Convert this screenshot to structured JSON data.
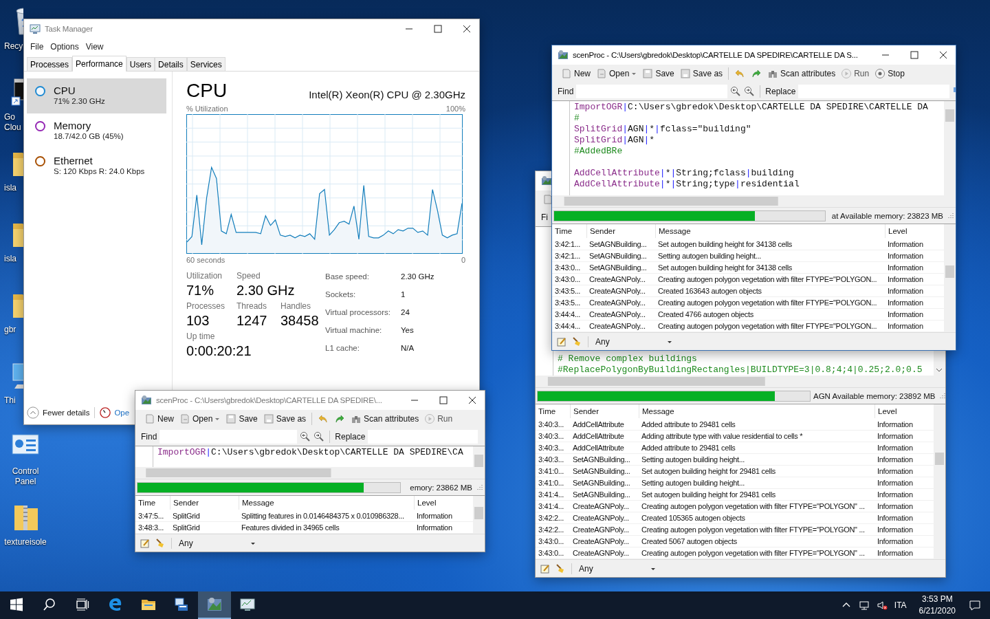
{
  "desktop_icons": [
    {
      "kind": "recycle",
      "label": "Recy"
    },
    {
      "kind": "terminal",
      "label": "Go Clou"
    },
    {
      "kind": "folder",
      "label": "isla"
    },
    {
      "kind": "folder",
      "label": "isla"
    },
    {
      "kind": "folder",
      "label": "gbr"
    },
    {
      "kind": "pc",
      "label": "Thi"
    },
    {
      "kind": "control",
      "label": "Control Panel"
    },
    {
      "kind": "zip",
      "label": "textureisole"
    }
  ],
  "task_manager": {
    "title": "Task Manager",
    "menu": [
      "File",
      "Options",
      "View"
    ],
    "tabs": [
      {
        "label": "Processes",
        "selected": false
      },
      {
        "label": "Performance",
        "selected": true
      },
      {
        "label": "Users",
        "selected": false
      },
      {
        "label": "Details",
        "selected": false
      },
      {
        "label": "Services",
        "selected": false
      }
    ],
    "resources": [
      {
        "name": "CPU",
        "detail": "71%  2.30 GHz",
        "selected": true,
        "color": "#1f8ad2"
      },
      {
        "name": "Memory",
        "detail": "18.7/42.0 GB (45%)",
        "selected": false,
        "color": "#9528b4"
      },
      {
        "name": "Ethernet",
        "detail": "S: 120 Kbps  R: 24.0 Kbps",
        "selected": false,
        "color": "#a74f01"
      }
    ],
    "heading": "CPU",
    "model": "Intel(R) Xeon(R) CPU @ 2.30GHz",
    "graph_label": "% Utilization",
    "graph_max": "100%",
    "graph_span": "60 seconds",
    "graph_min": "0",
    "stats": [
      {
        "label": "Utilization",
        "value": "71%"
      },
      {
        "label": "Speed",
        "value": "2.30 GHz"
      },
      {
        "label": "Processes",
        "value": "103"
      },
      {
        "label": "Threads",
        "value": "1247"
      },
      {
        "label": "Handles",
        "value": "38458"
      }
    ],
    "uptime": {
      "label": "Up time",
      "value": "0:00:20:21"
    },
    "specs": [
      {
        "label": "Base speed:",
        "value": "2.30 GHz"
      },
      {
        "label": "Sockets:",
        "value": "1"
      },
      {
        "label": "Virtual processors:",
        "value": "24"
      },
      {
        "label": "Virtual machine:",
        "value": "Yes"
      },
      {
        "label": "L1 cache:",
        "value": "N/A"
      }
    ],
    "footer": {
      "fewer": "Fewer details",
      "open": "Ope"
    }
  },
  "scenproc_windows": [
    {
      "kind": "full",
      "active": true,
      "title": "scenProc - C:\\Users\\gbredok\\Desktop\\CARTELLE DA SPEDIRE\\CARTELLE DA S...",
      "toolbar": [
        {
          "kind": "new",
          "label": "New"
        },
        {
          "kind": "open",
          "label": "Open"
        },
        {
          "kind": "save",
          "label": "Save"
        },
        {
          "kind": "saveas",
          "label": "Save as"
        },
        {
          "kind": "undo"
        },
        {
          "kind": "redo"
        },
        {
          "kind": "scan",
          "label": "Scan attributes"
        },
        {
          "kind": "run",
          "label": "Run"
        },
        {
          "kind": "stop",
          "label": "Stop"
        }
      ],
      "find_label": "Find",
      "replace_label": "Replace",
      "code": [
        {
          "kind": "code",
          "parts": [
            {
              "kind": "command",
              "text": "ImportOGR"
            },
            {
              "kind": "pipe",
              "text": "|"
            },
            {
              "kind": "text",
              "text": "C:\\Users\\gbredok\\Desktop\\CARTELLE DA SPEDIRE\\CARTELLE DA"
            }
          ]
        },
        {
          "kind": "code",
          "parts": [
            {
              "kind": "comment",
              "text": "#"
            }
          ]
        },
        {
          "kind": "code",
          "parts": [
            {
              "kind": "command",
              "text": "SplitGrid"
            },
            {
              "kind": "pipe",
              "text": "|"
            },
            {
              "kind": "text",
              "text": "AGN"
            },
            {
              "kind": "pipe",
              "text": "|"
            },
            {
              "kind": "text",
              "text": "*"
            },
            {
              "kind": "pipe",
              "text": "|"
            },
            {
              "kind": "text",
              "text": "fclass=\"building\""
            }
          ]
        },
        {
          "kind": "code",
          "parts": [
            {
              "kind": "command",
              "text": "SplitGrid"
            },
            {
              "kind": "pipe",
              "text": "|"
            },
            {
              "kind": "text",
              "text": "AGN"
            },
            {
              "kind": "pipe",
              "text": "|"
            },
            {
              "kind": "text",
              "text": "*"
            }
          ]
        },
        {
          "kind": "code",
          "parts": [
            {
              "kind": "comment",
              "text": "#AddedBRe"
            }
          ]
        },
        {
          "kind": "blank"
        },
        {
          "kind": "code",
          "parts": [
            {
              "kind": "command",
              "text": "AddCellAttribute"
            },
            {
              "kind": "pipe",
              "text": "|"
            },
            {
              "kind": "text",
              "text": "*"
            },
            {
              "kind": "pipe",
              "text": "|"
            },
            {
              "kind": "text",
              "text": "String;fclass"
            },
            {
              "kind": "pipe",
              "text": "|"
            },
            {
              "kind": "text",
              "text": "building"
            }
          ]
        },
        {
          "kind": "code",
          "parts": [
            {
              "kind": "command",
              "text": "AddCellAttribute"
            },
            {
              "kind": "pipe",
              "text": "|"
            },
            {
              "kind": "text",
              "text": "*"
            },
            {
              "kind": "pipe",
              "text": "|"
            },
            {
              "kind": "text",
              "text": "String;type"
            },
            {
              "kind": "pipe",
              "text": "|"
            },
            {
              "kind": "text",
              "text": "residential"
            }
          ]
        }
      ],
      "progress": {
        "level": 0.74,
        "status": "at Available memory: 23823 MB"
      },
      "log": {
        "columns": [
          "Time",
          "Sender",
          "Message",
          "Level"
        ],
        "rows": [
          [
            "3:42:1...",
            "SetAGNBuilding...",
            "Set autogen building height for 34138 cells",
            "Information"
          ],
          [
            "3:42:1...",
            "SetAGNBuilding...",
            "Setting autogen building height...",
            "Information"
          ],
          [
            "3:43:0...",
            "SetAGNBuilding...",
            "Set autogen building height for 34138 cells",
            "Information"
          ],
          [
            "3:43:0...",
            "CreateAGNPoly...",
            "Creating autogen polygon vegetation with filter FTYPE=\"POLYGON...",
            "Information"
          ],
          [
            "3:43:5...",
            "CreateAGNPoly...",
            "Created 163643 autogen objects",
            "Information"
          ],
          [
            "3:43:5...",
            "CreateAGNPoly...",
            "Creating autogen polygon vegetation with filter FTYPE=\"POLYGON...",
            "Information"
          ],
          [
            "3:44:4...",
            "CreateAGNPoly...",
            "Created 4766 autogen objects",
            "Information"
          ],
          [
            "3:44:4...",
            "CreateAGNPoly...",
            "Creating autogen polygon vegetation with filter FTYPE=\"POLYGON...",
            "Information"
          ]
        ]
      },
      "filter": "Any"
    },
    {
      "kind": "covered",
      "active": false,
      "find_label": "Fi",
      "code": [
        {
          "kind": "code",
          "parts": [
            {
              "kind": "comment",
              "text": "# Remove complex buildings"
            }
          ]
        },
        {
          "kind": "code",
          "parts": [
            {
              "kind": "comment",
              "text": "#ReplacePolygonByBuildingRectangles|BUILDTYPE=3|0.8;4;4|0.25;2.0;0.5"
            }
          ]
        }
      ],
      "progress": {
        "level": 0.87,
        "status": "AGN Available memory: 23892 MB"
      },
      "log": {
        "columns": [
          "Time",
          "Sender",
          "Message",
          "Level"
        ],
        "rows": [
          [
            "3:40:3...",
            "AddCellAttribute",
            "Added attribute to 29481 cells",
            "Information"
          ],
          [
            "3:40:3...",
            "AddCellAttribute",
            "Adding attribute type with value residential to cells *",
            "Information"
          ],
          [
            "3:40:3...",
            "AddCellAttribute",
            "Added attribute to 29481 cells",
            "Information"
          ],
          [
            "3:40:3...",
            "SetAGNBuilding...",
            "Setting autogen building height...",
            "Information"
          ],
          [
            "3:41:0...",
            "SetAGNBuilding...",
            "Set autogen building height for 29481 cells",
            "Information"
          ],
          [
            "3:41:0...",
            "SetAGNBuilding...",
            "Setting autogen building height...",
            "Information"
          ],
          [
            "3:41:4...",
            "SetAGNBuilding...",
            "Set autogen building height for 29481 cells",
            "Information"
          ],
          [
            "3:41:4...",
            "CreateAGNPoly...",
            "Creating autogen polygon vegetation with filter FTYPE=\"POLYGON\" ...",
            "Information"
          ],
          [
            "3:42:2...",
            "CreateAGNPoly...",
            "Created 105365 autogen objects",
            "Information"
          ],
          [
            "3:42:2...",
            "CreateAGNPoly...",
            "Creating autogen polygon vegetation with filter FTYPE=\"POLYGON\" ...",
            "Information"
          ],
          [
            "3:43:0...",
            "CreateAGNPoly...",
            "Created 5067 autogen objects",
            "Information"
          ],
          [
            "3:43:0...",
            "CreateAGNPoly...",
            "Creating autogen polygon vegetation with filter FTYPE=\"POLYGON\" ...",
            "Information"
          ]
        ]
      },
      "filter": "Any"
    },
    {
      "kind": "full",
      "active": false,
      "title": "scenProc - C:\\Users\\gbredok\\Desktop\\CARTELLE DA SPEDIRE\\...",
      "toolbar": [
        {
          "kind": "new",
          "label": "New"
        },
        {
          "kind": "open",
          "label": "Open"
        },
        {
          "kind": "save",
          "label": "Save"
        },
        {
          "kind": "saveas",
          "label": "Save as"
        },
        {
          "kind": "undo"
        },
        {
          "kind": "redo"
        },
        {
          "kind": "scan",
          "label": "Scan attributes"
        },
        {
          "kind": "run",
          "label": "Run"
        }
      ],
      "find_label": "Find",
      "replace_label": "Replace",
      "code": [
        {
          "kind": "code",
          "parts": [
            {
              "kind": "command",
              "text": "ImportOGR"
            },
            {
              "kind": "pipe",
              "text": "|"
            },
            {
              "kind": "text",
              "text": "C:\\Users\\gbredok\\Desktop\\CARTELLE DA SPEDIRE\\CA"
            }
          ]
        }
      ],
      "progress": {
        "level": 0.86,
        "status": "emory: 23862 MB"
      },
      "log": {
        "columns": [
          "Time",
          "Sender",
          "Message",
          "Level"
        ],
        "rows": [
          [
            "3:47:5...",
            "SplitGrid",
            "Splitting features in 0.0146484375 x 0.010986328...",
            "Information"
          ],
          [
            "3:48:3...",
            "SplitGrid",
            "Features divided in 34965 cells",
            "Information"
          ]
        ]
      },
      "filter": "Any"
    }
  ],
  "taskbar": {
    "apps": [
      {
        "kind": "start",
        "active": false
      },
      {
        "kind": "search",
        "active": false
      },
      {
        "kind": "taskview",
        "active": false
      },
      {
        "kind": "browser",
        "active": false
      },
      {
        "kind": "explorer",
        "active": false
      },
      {
        "kind": "remote",
        "active": false
      },
      {
        "kind": "scenproc",
        "active": true
      },
      {
        "kind": "taskmanager",
        "active": false
      }
    ],
    "language": "ITA",
    "time": "3:53 PM",
    "date": "6/21/2020"
  }
}
